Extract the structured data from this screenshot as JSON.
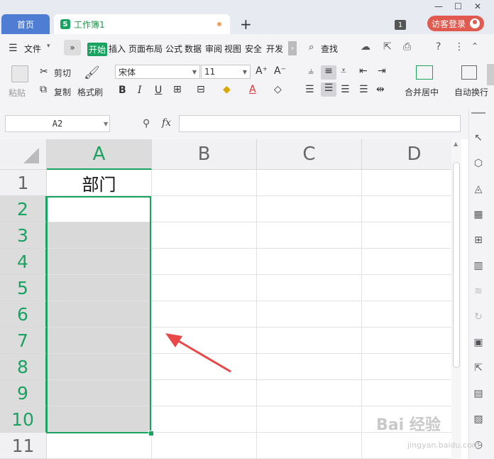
{
  "titlebar": {
    "home_tab": "首页",
    "doc_tab": "工作簿1",
    "doc_icon_letter": "S",
    "new_tab": "+",
    "badge": "1",
    "login": "访客登录"
  },
  "menu": {
    "file": "文件",
    "items": [
      "开始",
      "插入",
      "页面布局",
      "公式",
      "数据",
      "审阅",
      "视图",
      "安全",
      "开发"
    ],
    "search": "查找"
  },
  "ribbon": {
    "paste": "粘贴",
    "cut": "剪切",
    "copy": "复制",
    "format_painter": "格式刷",
    "font_name": "宋体",
    "font_size": "11",
    "merge_center": "合并居中",
    "auto_wrap": "自动换行"
  },
  "formula_bar": {
    "cell_ref": "A2",
    "fx": "fx",
    "formula": ""
  },
  "sheet": {
    "columns": [
      "A",
      "B",
      "C",
      "D"
    ],
    "rows": [
      "1",
      "2",
      "3",
      "4",
      "5",
      "6",
      "7",
      "8",
      "9",
      "10",
      "11"
    ],
    "selected_column": "A",
    "selected_rows": [
      "2",
      "3",
      "4",
      "5",
      "6",
      "7",
      "8",
      "9",
      "10"
    ],
    "cells": {
      "A1": "部门"
    }
  },
  "watermark": {
    "brand": "Bai 经验",
    "url": "jingyan.baidu.com"
  },
  "colors": {
    "accent_green": "#1aa260",
    "home_tab_blue": "#4f7dd4",
    "login_red": "#e05a4f",
    "arrow_red": "#e84848"
  }
}
